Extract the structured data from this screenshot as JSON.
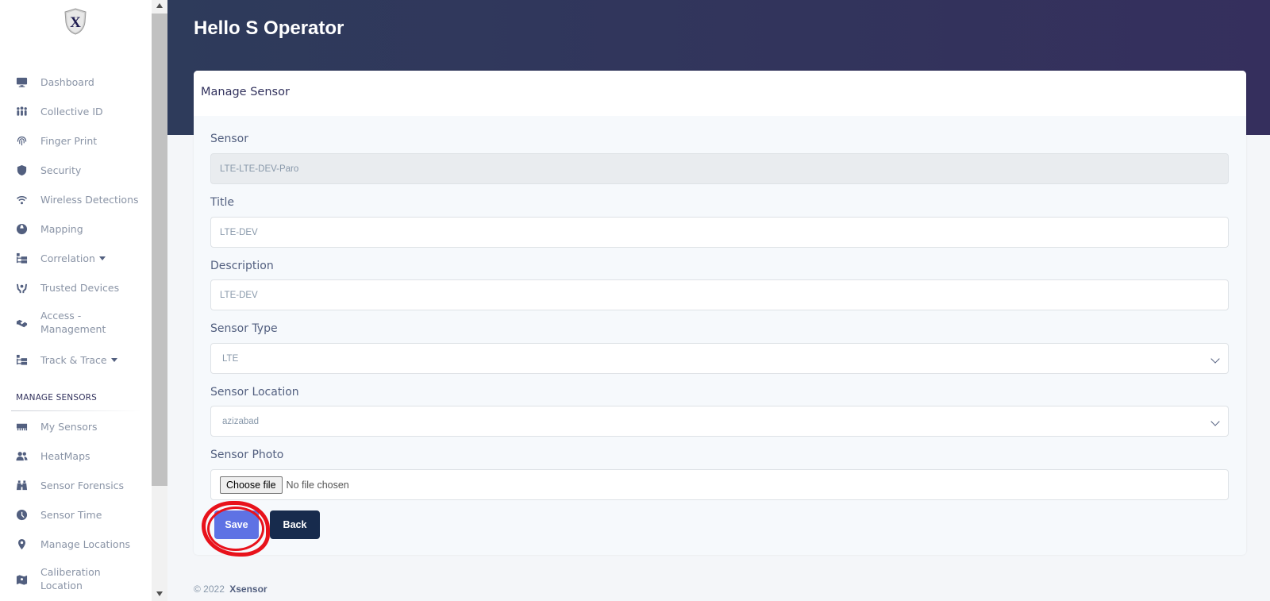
{
  "sidebar": {
    "logo_letter": "X",
    "items": [
      {
        "label": "Dashboard",
        "icon": "monitor-icon"
      },
      {
        "label": "Collective ID",
        "icon": "group-icon"
      },
      {
        "label": "Finger Print",
        "icon": "fingerprint-icon"
      },
      {
        "label": "Security",
        "icon": "shield-icon"
      },
      {
        "label": "Wireless Detections",
        "icon": "wifi-icon"
      },
      {
        "label": "Mapping",
        "icon": "globe-icon"
      },
      {
        "label": "Correlation",
        "icon": "sitemap-icon",
        "dropdown": true
      },
      {
        "label": "Trusted Devices",
        "icon": "hands-icon"
      },
      {
        "label": "Access -",
        "label2": "Management",
        "icon": "handshake-icon"
      },
      {
        "label": "Track & Trace",
        "icon": "sitemap-icon",
        "dropdown": true
      }
    ],
    "section_heading": "MANAGE SENSORS",
    "section_items": [
      {
        "label": "My Sensors",
        "icon": "ethernet-icon"
      },
      {
        "label": "HeatMaps",
        "icon": "users-icon"
      },
      {
        "label": "Sensor Forensics",
        "icon": "binoculars-icon"
      },
      {
        "label": "Sensor Time",
        "icon": "clock-icon"
      },
      {
        "label": "Manage Locations",
        "icon": "map-marker-icon"
      },
      {
        "label": "Caliberation",
        "label2": "Location",
        "icon": "map-icon"
      }
    ]
  },
  "header": {
    "greeting": "Hello S Operator"
  },
  "card": {
    "title": "Manage Sensor",
    "fields": {
      "sensor": {
        "label": "Sensor",
        "value": "LTE-LTE-DEV-Paro"
      },
      "title": {
        "label": "Title",
        "value": "LTE-DEV"
      },
      "description": {
        "label": "Description",
        "value": "LTE-DEV"
      },
      "sensor_type": {
        "label": "Sensor Type",
        "value": "LTE"
      },
      "sensor_location": {
        "label": "Sensor Location",
        "value": "azizabad"
      },
      "sensor_photo": {
        "label": "Sensor Photo",
        "button": "Choose file",
        "status": "No file chosen"
      }
    },
    "buttons": {
      "save": "Save",
      "back": "Back"
    }
  },
  "footer": {
    "copyright": "© 2022",
    "brand": "Xsensor"
  },
  "colors": {
    "primary": "#5e72e4",
    "dark": "#172b4d",
    "highlight": "#e8121b",
    "header_start": "#2e3b5b",
    "header_end": "#352f5d"
  }
}
